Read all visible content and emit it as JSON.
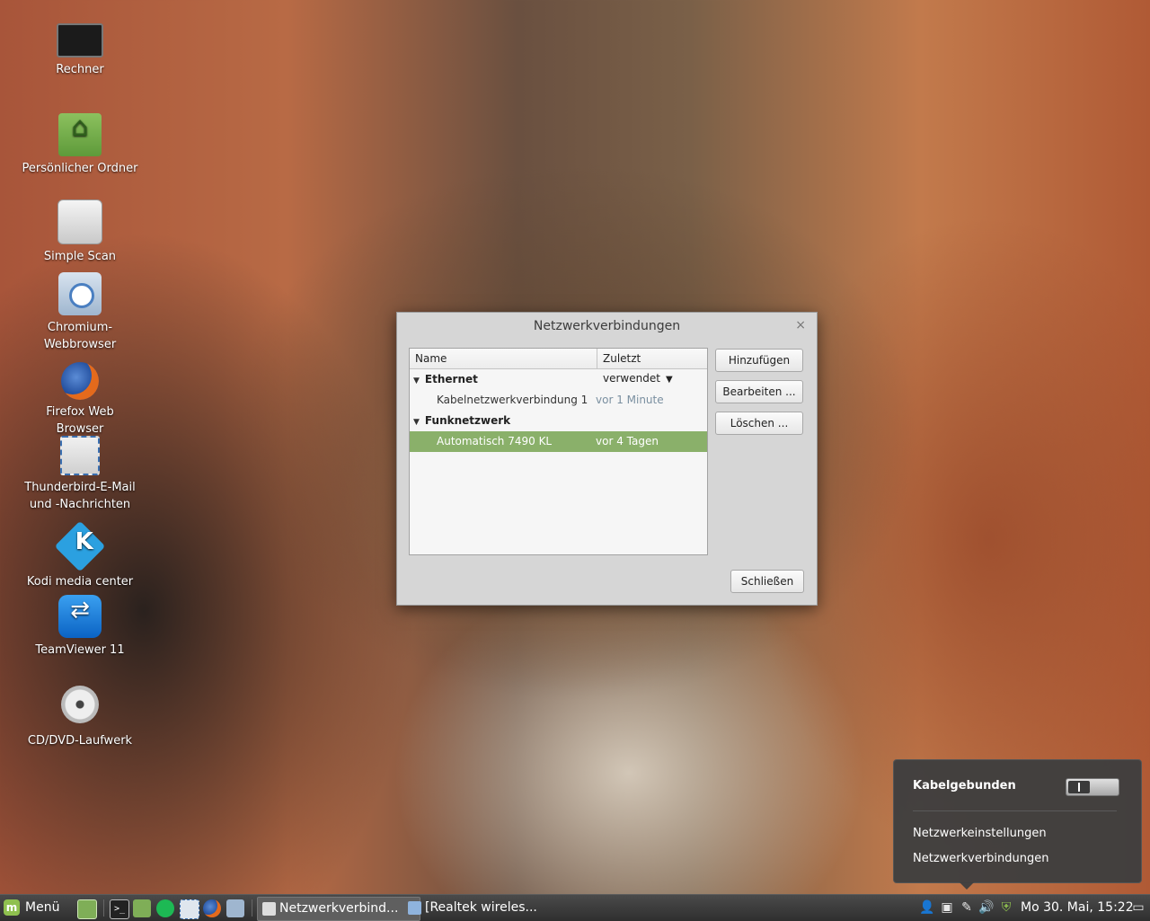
{
  "desktop": {
    "icons": [
      {
        "label": "Rechner"
      },
      {
        "label": "Persönlicher Ordner"
      },
      {
        "label": "Simple Scan"
      },
      {
        "label": "Chromium-Webbrowser"
      },
      {
        "label": "Firefox Web Browser"
      },
      {
        "label": "Thunderbird-E-Mail und -Nachrichten"
      },
      {
        "label": "Kodi media center"
      },
      {
        "label": "TeamViewer 11"
      },
      {
        "label": "CD/DVD-Laufwerk"
      }
    ]
  },
  "dialog": {
    "title": "Netzwerkverbindungen",
    "close_glyph": "×",
    "columns": {
      "name": "Name",
      "last_used": "Zuletzt verwendet",
      "sort_glyph": "▼"
    },
    "groups": [
      {
        "label": "Ethernet",
        "items": [
          {
            "name": "Kabelnetzwerkverbindung 1",
            "last_used": "vor 1 Minute",
            "selected": false
          }
        ]
      },
      {
        "label": "Funknetzwerk",
        "items": [
          {
            "name": "Automatisch 7490 KL",
            "last_used": "vor 4 Tagen",
            "selected": true
          }
        ]
      }
    ],
    "expand_glyph": "▼",
    "buttons": {
      "add": "Hinzufügen",
      "edit": "Bearbeiten ...",
      "delete": "Löschen ...",
      "close": "Schließen"
    }
  },
  "network_popup": {
    "heading": "Kabelgebunden",
    "switch_on": false,
    "links": [
      "Netzwerkeinstellungen",
      "Netzwerkverbindungen"
    ]
  },
  "taskbar": {
    "menu_label": "Menü",
    "tasks": [
      {
        "label": "Netzwerkverbind...",
        "active": true
      },
      {
        "label": "[Realtek wireles...",
        "active": false
      }
    ],
    "clock": "Mo 30. Mai, 15:22"
  },
  "colors": {
    "selection": "#8ab06a",
    "mint_accent": "#8fc04f"
  }
}
